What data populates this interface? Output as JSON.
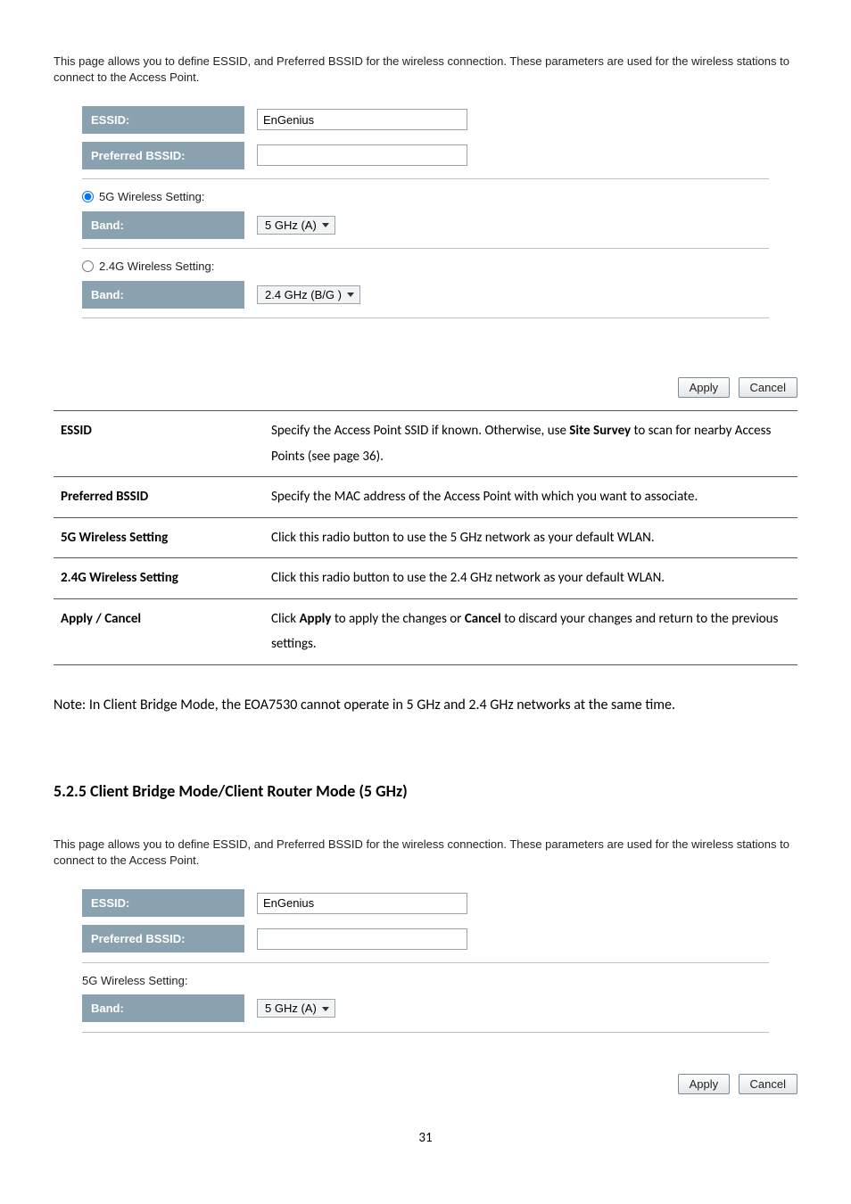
{
  "intro1": "This page allows you to define ESSID, and Preferred BSSID for the wireless connection. These parameters are used for the wireless stations to connect to the Access Point.",
  "form1": {
    "essid_label": "ESSID:",
    "essid_value": "EnGenius",
    "bssid_label": "Preferred BSSID:",
    "bssid_value": "",
    "radio5_label": "5G Wireless Setting:",
    "band5_label": "Band:",
    "band5_value": "5 GHz (A)",
    "radio24_label": "2.4G Wireless Setting:",
    "band24_label": "Band:",
    "band24_value": "2.4 GHz (B/G )"
  },
  "buttons": {
    "apply": "Apply",
    "cancel": "Cancel"
  },
  "defs": [
    {
      "term": "ESSID",
      "desc_a": "Specify the Access Point SSID if known. Otherwise, use ",
      "desc_bold": "Site Survey",
      "desc_b": " to scan for nearby Access Points (see page 36)."
    },
    {
      "term": "Preferred BSSID",
      "desc": "Specify the MAC address of the Access Point with which you want to associate."
    },
    {
      "term": "5G Wireless Setting",
      "desc": "Click this radio button to use the 5 GHz network as your default WLAN."
    },
    {
      "term": "2.4G Wireless Setting",
      "desc": "Click this radio button to use the 2.4 GHz network as your default WLAN."
    },
    {
      "term": "Apply / Cancel",
      "desc_a": "Click ",
      "desc_bold1": "Apply",
      "desc_mid": " to apply the changes or ",
      "desc_bold2": "Cancel",
      "desc_b": " to discard your changes and return to the previous settings."
    }
  ],
  "note": "Note: In Client Bridge Mode, the EOA7530 cannot operate in 5 GHz and 2.4 GHz networks at the same time.",
  "section_head": "5.2.5 Client Bridge Mode/Client Router Mode (5 GHz)",
  "intro2": "This page allows you to define ESSID, and Preferred BSSID for the wireless connection. These parameters are used for the wireless stations to connect to the Access Point.",
  "form2": {
    "essid_label": "ESSID:",
    "essid_value": "EnGenius",
    "bssid_label": "Preferred BSSID:",
    "bssid_value": "",
    "setting_label": "5G Wireless Setting:",
    "band_label": "Band:",
    "band_value": "5 GHz (A)"
  },
  "page_num": "31"
}
